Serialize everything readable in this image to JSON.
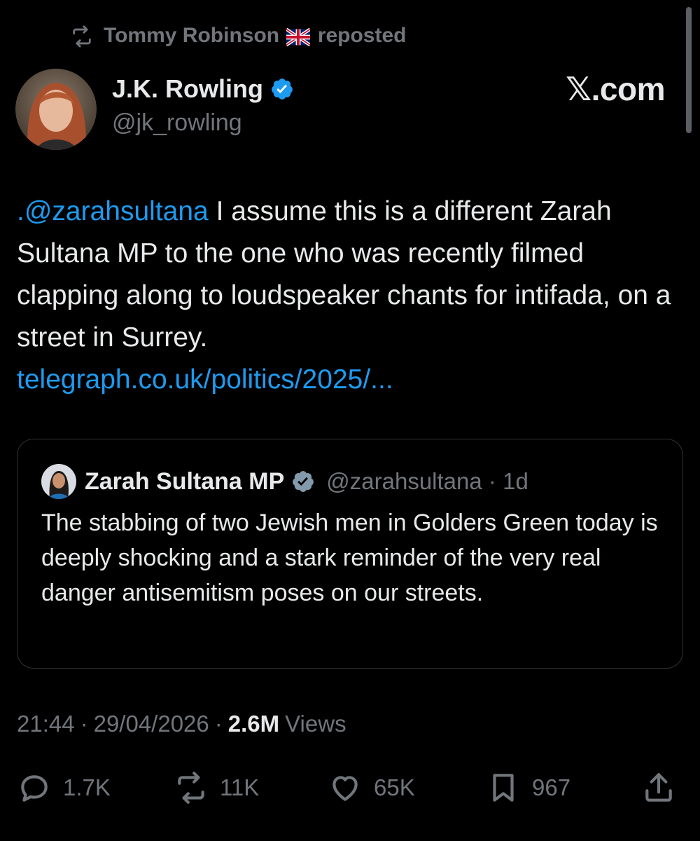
{
  "repost": {
    "user": "Tommy Robinson",
    "label": "reposted"
  },
  "author": {
    "name": "J.K. Rowling",
    "handle": "@jk_rowling"
  },
  "brand": "𝕏.com",
  "tweet": {
    "mention": ".@zarahsultana",
    "text": " I assume this is a different Zarah Sultana MP to the one who was recently filmed clapping along to loudspeaker chants for intifada, on a street in Surrey.",
    "link": "telegraph.co.uk/politics/2025/..."
  },
  "quote": {
    "name": "Zarah Sultana MP",
    "handle": "@zarahsultana",
    "separator": "·",
    "age": "1d",
    "text": "The stabbing of two Jewish men in Golders Green today is deeply shocking and a stark reminder of the very real danger antisemitism poses on our streets."
  },
  "meta": {
    "time": "21:44",
    "date": "29/04/2026",
    "sep": "·",
    "views_count": "2.6M",
    "views_label": "Views"
  },
  "actions": {
    "replies": "1.7K",
    "reposts": "11K",
    "likes": "65K",
    "bookmarks": "967"
  },
  "icons": [
    "repost-icon",
    "uk-flag-icon",
    "verified-icon",
    "reply-icon",
    "like-icon",
    "bookmark-icon",
    "share-icon"
  ],
  "colors": {
    "background": "#000000",
    "text": "#e7e9ea",
    "muted": "#71767b",
    "link": "#1d9bf0",
    "verified": "#1d9bf0",
    "border": "#2f3336"
  }
}
